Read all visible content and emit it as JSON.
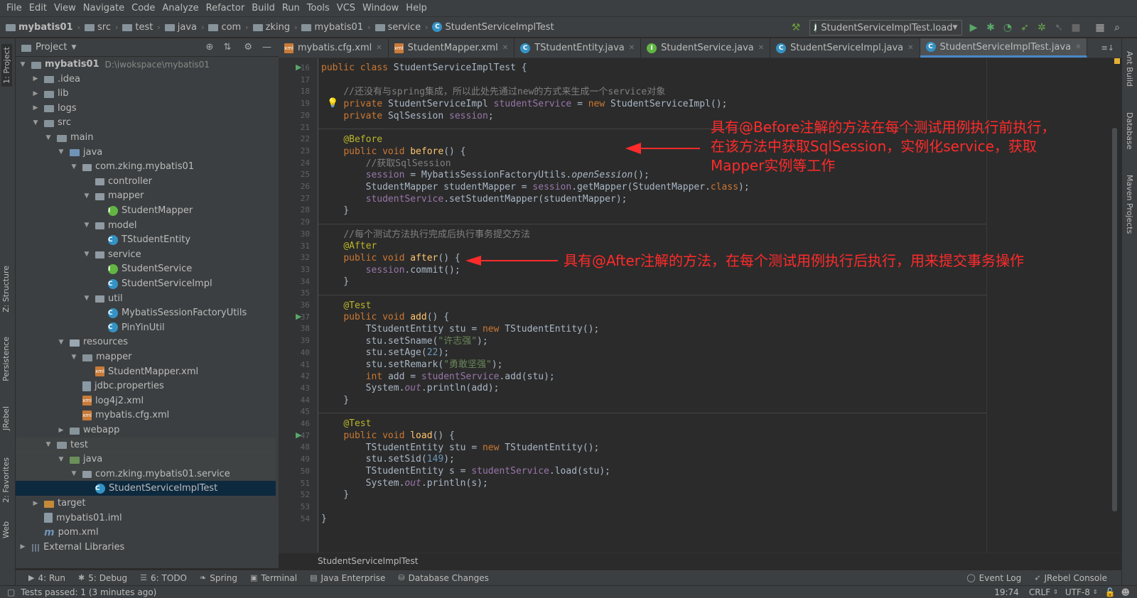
{
  "menu": [
    "File",
    "Edit",
    "View",
    "Navigate",
    "Code",
    "Analyze",
    "Refactor",
    "Build",
    "Run",
    "Tools",
    "VCS",
    "Window",
    "Help"
  ],
  "breadcrumbs": [
    "mybatis01",
    "src",
    "test",
    "java",
    "com",
    "zking",
    "mybatis01",
    "service",
    "StudentServiceImplTest"
  ],
  "run_config": "StudentServiceImplTest.load",
  "project_panel": {
    "title": "Project",
    "tree": [
      {
        "label": "mybatis01",
        "path": "D:\\iwokspace\\mybatis01",
        "icon": "folder-icon",
        "depth": 0,
        "arrow": "▼"
      },
      {
        "label": ".idea",
        "icon": "folder-icon",
        "depth": 1,
        "arrow": "▶"
      },
      {
        "label": "lib",
        "icon": "folder-icon",
        "depth": 1,
        "arrow": "▶"
      },
      {
        "label": "logs",
        "icon": "folder-icon",
        "depth": 1,
        "arrow": "▶"
      },
      {
        "label": "src",
        "icon": "folder-icon",
        "depth": 1,
        "arrow": "▼"
      },
      {
        "label": "main",
        "icon": "folder-icon",
        "depth": 2,
        "arrow": "▼"
      },
      {
        "label": "java",
        "icon": "source-folder-icon",
        "depth": 3,
        "arrow": "▼"
      },
      {
        "label": "com.zking.mybatis01",
        "icon": "package-icon",
        "depth": 4,
        "arrow": "▼"
      },
      {
        "label": "controller",
        "icon": "package-icon",
        "depth": 5,
        "arrow": ""
      },
      {
        "label": "mapper",
        "icon": "package-icon",
        "depth": 5,
        "arrow": "▼"
      },
      {
        "label": "StudentMapper",
        "icon": "interface-icon",
        "depth": 6,
        "arrow": ""
      },
      {
        "label": "model",
        "icon": "package-icon",
        "depth": 5,
        "arrow": "▼"
      },
      {
        "label": "TStudentEntity",
        "icon": "class-icon",
        "depth": 6,
        "arrow": ""
      },
      {
        "label": "service",
        "icon": "package-icon",
        "depth": 5,
        "arrow": "▼"
      },
      {
        "label": "StudentService",
        "icon": "interface-icon",
        "depth": 6,
        "arrow": ""
      },
      {
        "label": "StudentServiceImpl",
        "icon": "class-icon",
        "depth": 6,
        "arrow": ""
      },
      {
        "label": "util",
        "icon": "package-icon",
        "depth": 5,
        "arrow": "▼"
      },
      {
        "label": "MybatisSessionFactoryUtils",
        "icon": "class-icon",
        "depth": 6,
        "arrow": ""
      },
      {
        "label": "PinYinUtil",
        "icon": "class-icon",
        "depth": 6,
        "arrow": ""
      },
      {
        "label": "resources",
        "icon": "resources-folder-icon",
        "depth": 3,
        "arrow": "▼"
      },
      {
        "label": "mapper",
        "icon": "folder-icon",
        "depth": 4,
        "arrow": "▼"
      },
      {
        "label": "StudentMapper.xml",
        "icon": "xml-file-icon",
        "depth": 5,
        "arrow": ""
      },
      {
        "label": "jdbc.properties",
        "icon": "properties-file-icon",
        "depth": 4,
        "arrow": ""
      },
      {
        "label": "log4j2.xml",
        "icon": "xml-file-icon",
        "depth": 4,
        "arrow": ""
      },
      {
        "label": "mybatis.cfg.xml",
        "icon": "xml-file-icon",
        "depth": 4,
        "arrow": ""
      },
      {
        "label": "webapp",
        "icon": "folder-icon",
        "depth": 3,
        "arrow": "▶"
      },
      {
        "label": "test",
        "icon": "folder-icon",
        "depth": 2,
        "arrow": "▼"
      },
      {
        "label": "java",
        "icon": "test-folder-icon",
        "depth": 3,
        "arrow": "▼"
      },
      {
        "label": "com.zking.mybatis01.service",
        "icon": "package-icon",
        "depth": 4,
        "arrow": "▼"
      },
      {
        "label": "StudentServiceImplTest",
        "icon": "class-icon",
        "depth": 5,
        "arrow": "",
        "selected": true
      },
      {
        "label": "target",
        "icon": "excluded-folder-icon",
        "depth": 1,
        "arrow": "▶"
      },
      {
        "label": "mybatis01.iml",
        "icon": "iml-file-icon",
        "depth": 1,
        "arrow": ""
      },
      {
        "label": "pom.xml",
        "icon": "maven-icon",
        "depth": 1,
        "arrow": ""
      },
      {
        "label": "External Libraries",
        "icon": "library-icon",
        "depth": 0,
        "arrow": "▶"
      }
    ]
  },
  "editor_tabs": [
    {
      "label": "mybatis.cfg.xml",
      "icon": "xml-file-icon"
    },
    {
      "label": "StudentMapper.xml",
      "icon": "xml-file-icon"
    },
    {
      "label": "TStudentEntity.java",
      "icon": "class-icon"
    },
    {
      "label": "StudentService.java",
      "icon": "interface-icon"
    },
    {
      "label": "StudentServiceImpl.java",
      "icon": "class-icon"
    },
    {
      "label": "StudentServiceImplTest.java",
      "icon": "class-icon",
      "active": true
    }
  ],
  "line_numbers": [
    "16",
    "17",
    "18",
    "19",
    "20",
    "21",
    "22",
    "23",
    "24",
    "25",
    "26",
    "27",
    "28",
    "29",
    "30",
    "31",
    "32",
    "33",
    "34",
    "35",
    "36",
    "37",
    "38",
    "39",
    "40",
    "41",
    "42",
    "43",
    "44",
    "45",
    "46",
    "47",
    "48",
    "49",
    "50",
    "51",
    "52",
    "53",
    "54"
  ],
  "annotations": {
    "before": [
      "具有@Before注解的方法在每个测试用例执行前执行，",
      "在该方法中获取SqlSession，实例化service，获取",
      "Mapper实例等工作"
    ],
    "after": "具有@After注解的方法，在每个测试用例执行后执行，用来提交事务操作"
  },
  "editor_breadcrumb": "StudentServiceImplTest",
  "tool_windows": [
    {
      "label": "4: Run",
      "icon": "run-icon"
    },
    {
      "label": "5: Debug",
      "icon": "debug-icon"
    },
    {
      "label": "6: TODO",
      "icon": "todo-icon"
    },
    {
      "label": "Spring",
      "icon": "spring-icon"
    },
    {
      "label": "Terminal",
      "icon": "terminal-icon"
    },
    {
      "label": "Java Enterprise",
      "icon": "java-enterprise-icon"
    },
    {
      "label": "Database Changes",
      "icon": "database-changes-icon"
    }
  ],
  "tool_windows_right": [
    {
      "label": "Event Log",
      "icon": "event-log-icon"
    },
    {
      "label": "JRebel Console",
      "icon": "jrebel-icon"
    }
  ],
  "left_strip": [
    "1: Project",
    "Z: Structure",
    "Persistence",
    "JRebel",
    "2: Favorites",
    "Web"
  ],
  "right_strip": [
    "Ant Build",
    "Database",
    "Maven Projects"
  ],
  "status": {
    "message": "Tests passed: 1 (3 minutes ago)",
    "position": "19:74",
    "line_sep": "CRLF",
    "encoding": "UTF-8"
  },
  "colors": {
    "annotation": "#ff2b2b",
    "keyword": "#cc7832",
    "comment": "#808080",
    "annotation_code": "#bbb529",
    "field": "#9876aa",
    "string": "#6a8759",
    "active_tab": "#4a88c7"
  }
}
